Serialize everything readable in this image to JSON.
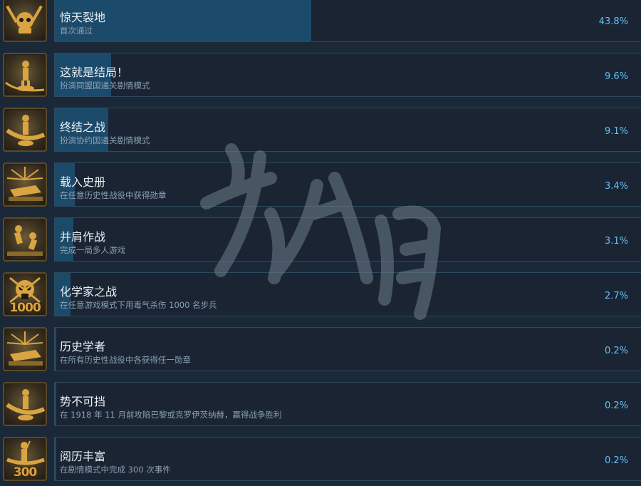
{
  "achievements": [
    {
      "title": "惊天裂地",
      "desc": "首次通过",
      "percent": "43.8%",
      "fill": 0.438,
      "icon": "skull-hammer-icon"
    },
    {
      "title": "这就是结局！",
      "desc": "扮演同盟国通关剧情模式",
      "percent": "9.6%",
      "fill": 0.096,
      "icon": "soldier-statue-icon"
    },
    {
      "title": "终结之战",
      "desc": "扮演协约国通关剧情模式",
      "percent": "9.1%",
      "fill": 0.091,
      "icon": "soldier-film-icon"
    },
    {
      "title": "载入史册",
      "desc": "在任意历史性战役中获得勋章",
      "percent": "3.4%",
      "fill": 0.034,
      "icon": "tank-sunburst-icon"
    },
    {
      "title": "并肩作战",
      "desc": "完成一局多人游戏",
      "percent": "3.1%",
      "fill": 0.031,
      "icon": "soldiers-fighting-icon"
    },
    {
      "title": "化学家之战",
      "desc": "在任意游戏模式下用毒气杀伤 1000 名步兵",
      "percent": "2.7%",
      "fill": 0.027,
      "icon": "gas-mask-skull-icon",
      "badge": "1000"
    },
    {
      "title": "历史学者",
      "desc": "在所有历史性战役中各获得任一勋章",
      "percent": "0.2%",
      "fill": 0.002,
      "icon": "tank-sunburst-icon"
    },
    {
      "title": "势不可挡",
      "desc": "在 1918 年 11 月前攻陷巴黎或克罗伊茨纳赫，赢得战争胜利",
      "percent": "0.2%",
      "fill": 0.002,
      "icon": "soldier-film-icon"
    },
    {
      "title": "阅历丰富",
      "desc": "在剧情模式中完成 300 次事件",
      "percent": "0.2%",
      "fill": 0.002,
      "icon": "soldier-rifle-icon",
      "badge": "300"
    }
  ],
  "colors": {
    "background": "#1b2838",
    "progress": "#1c4a6a",
    "percent_text": "#66c0f4",
    "icon_gold": "#d9a441"
  }
}
